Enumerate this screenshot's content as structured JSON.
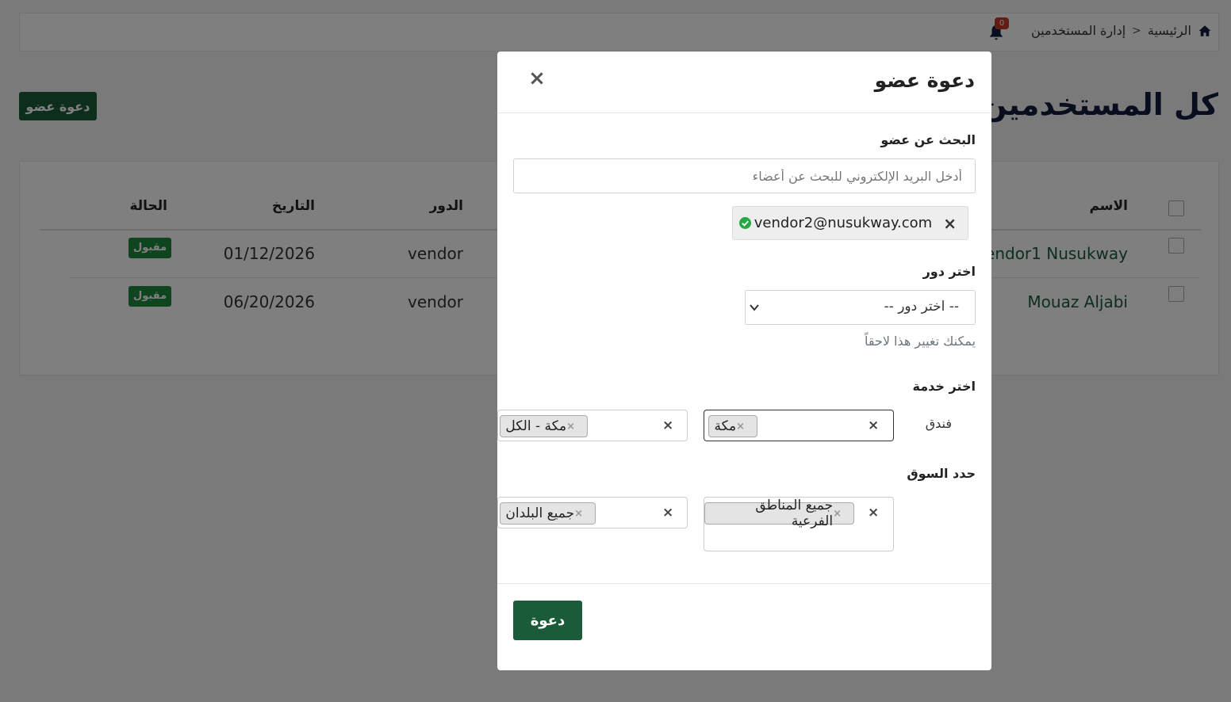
{
  "breadcrumb": {
    "home": "الرئيسية",
    "current": "إدارة المستخدمين"
  },
  "notifications": {
    "count": "0"
  },
  "page": {
    "title": "كل المستخدمين",
    "invite_button": "دعوة عضو"
  },
  "table": {
    "headers": {
      "name": "الاسم",
      "role": "الدور",
      "date": "التاريخ",
      "status": "الحالة"
    },
    "rows": [
      {
        "name": "Vendor1 Nusukway",
        "role": "vendor",
        "date": "01/12/2026",
        "status": "مقبول"
      },
      {
        "name": "Mouaz Aljabi",
        "role": "vendor",
        "date": "06/20/2026",
        "status": "مقبول"
      }
    ]
  },
  "modal": {
    "title": "دعوة عضو",
    "close": "×",
    "search_label": "البحث عن عضو",
    "search_placeholder": "أدخل البريد الإلكتروني للبحث عن أعضاء",
    "selected_email": "vendor2@nusukway.com",
    "role_label": "اختر دور",
    "role_value": "-- اختر دور --",
    "role_hint": "يمكنك تغيير هذا لاحقاً",
    "service_label": "اختر خدمة",
    "service_type": "فندق",
    "service_city_tag": "مكة",
    "service_scope_tag": "مكة - الكل",
    "market_label": "حدد السوق",
    "market_regions_tag": "جميع المناطق الفرعية",
    "market_countries_tag": "جميع البلدان",
    "submit": "دعوة"
  },
  "colors": {
    "brand_green": "#1a5c3a",
    "status_green": "#1f8a3d",
    "badge_red": "#c0392b"
  }
}
